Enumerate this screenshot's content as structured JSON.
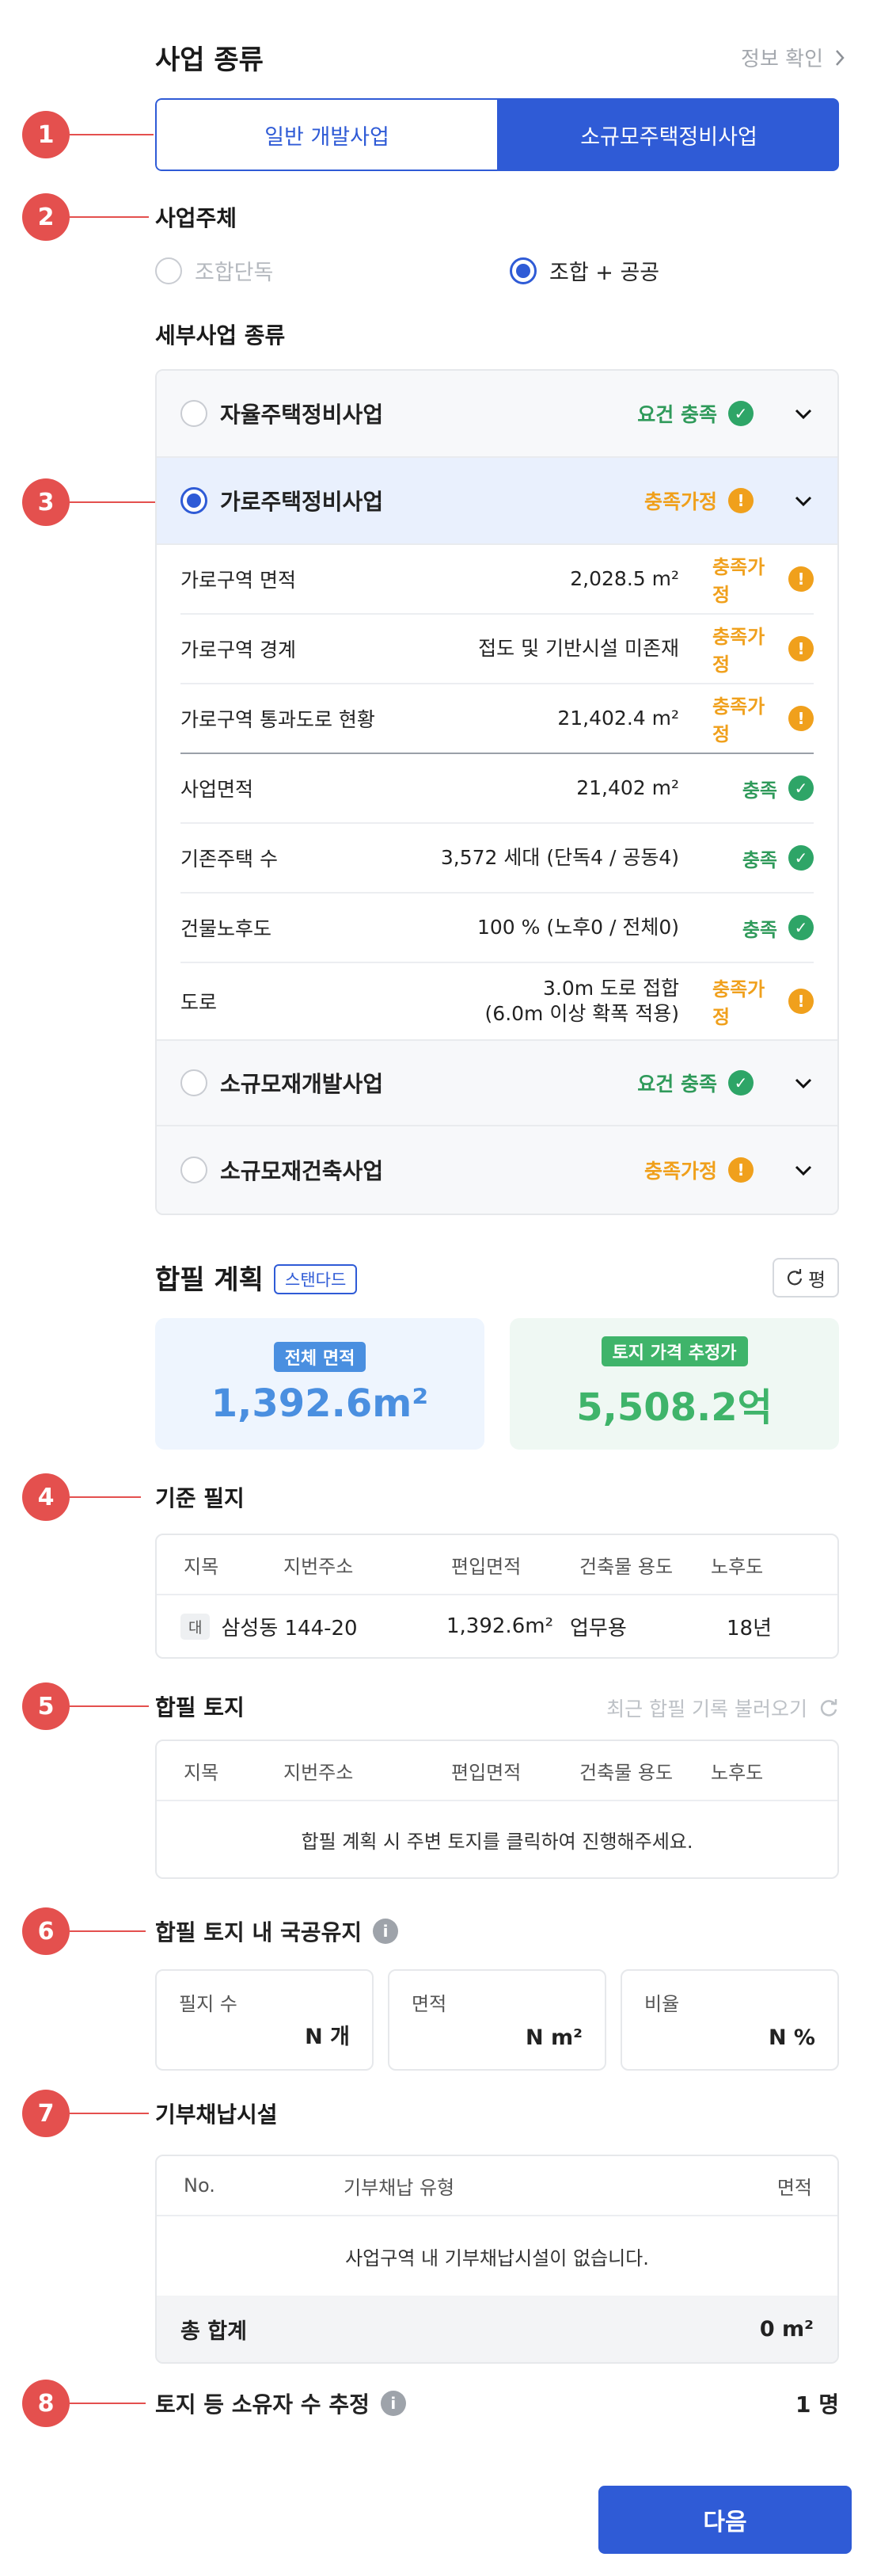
{
  "business_type": {
    "title": "사업 종류",
    "info_link": "정보 확인",
    "tabs": [
      "일반 개발사업",
      "소규모주택정비사업"
    ]
  },
  "operator": {
    "title": "사업주체",
    "options": [
      "조합단독",
      "조합 + 공공"
    ]
  },
  "sub_business": {
    "title": "세부사업 종류",
    "items": [
      {
        "name": "자율주택정비사업",
        "status": "요건 충족",
        "state": "ok"
      },
      {
        "name": "가로주택정비사업",
        "status": "충족가정",
        "state": "warn"
      },
      {
        "name": "소규모재개발사업",
        "status": "요건 충족",
        "state": "ok"
      },
      {
        "name": "소규모재건축사업",
        "status": "충족가정",
        "state": "warn"
      }
    ],
    "details": [
      {
        "label": "가로구역 면적",
        "value": "2,028.5 m²",
        "status": "충족가정",
        "state": "warn"
      },
      {
        "label": "가로구역 경계",
        "value": "접도 및 기반시설 미존재",
        "status": "충족가정",
        "state": "warn"
      },
      {
        "label": "가로구역 통과도로 현황",
        "value": "21,402.4 m²",
        "status": "충족가정",
        "state": "warn"
      },
      {
        "label": "사업면적",
        "value": "21,402 m²",
        "status": "충족",
        "state": "ok"
      },
      {
        "label": "기존주택 수",
        "value": "3,572 세대 (단독4 / 공동4)",
        "status": "충족",
        "state": "ok"
      },
      {
        "label": "건물노후도",
        "value": "100 % (노후0 / 전체0)",
        "status": "충족",
        "state": "ok"
      },
      {
        "label": "도로",
        "value_line1": "3.0m 도로 접합",
        "value_line2": "(6.0m 이상 확폭 적용)",
        "status": "충족가정",
        "state": "warn"
      }
    ]
  },
  "plan": {
    "title": "합필 계획",
    "badge": "스탠다드",
    "unit_button": "평",
    "total_area_label": "전체 면적",
    "total_area_value": "1,392.6m²",
    "land_price_label": "토지 가격 추정가",
    "land_price_value": "5,508.2억"
  },
  "base_lot": {
    "title": "기준 필지",
    "headers": [
      "지목",
      "지번주소",
      "편입면적",
      "건축물 용도",
      "노후도"
    ],
    "row": {
      "jimok": "대",
      "address": "삼성동 144-20",
      "area": "1,392.6m²",
      "use": "업무용",
      "age": "18년"
    }
  },
  "merged_land": {
    "title": "합필 토지",
    "recent_link": "최근 합필 기록 불러오기",
    "headers": [
      "지목",
      "지번주소",
      "편입면적",
      "건축물 용도",
      "노후도"
    ],
    "empty": "합필 계획 시 주변 토지를 클릭하여 진행해주세요."
  },
  "public_land": {
    "title": "합필 토지 내 국공유지",
    "cells": [
      {
        "label": "필지 수",
        "value": "N 개"
      },
      {
        "label": "면적",
        "value": "N m²"
      },
      {
        "label": "비율",
        "value": "N %"
      }
    ]
  },
  "donation": {
    "title": "기부채납시설",
    "headers": [
      "No.",
      "기부채납 유형",
      "면적"
    ],
    "empty": "사업구역 내 기부채납시설이 없습니다.",
    "total_label": "총 합계",
    "total_value": "0 m²"
  },
  "owners": {
    "title": "토지 등 소유자 수 추정",
    "value": "1 명"
  },
  "markers": [
    "1",
    "2",
    "3",
    "4",
    "5",
    "6",
    "7",
    "8"
  ],
  "next_button": "다음",
  "colors": {
    "primary": "#2f5bd6",
    "ok": "#2ea567",
    "warn": "#f0a01c",
    "marker": "#e4504e"
  }
}
